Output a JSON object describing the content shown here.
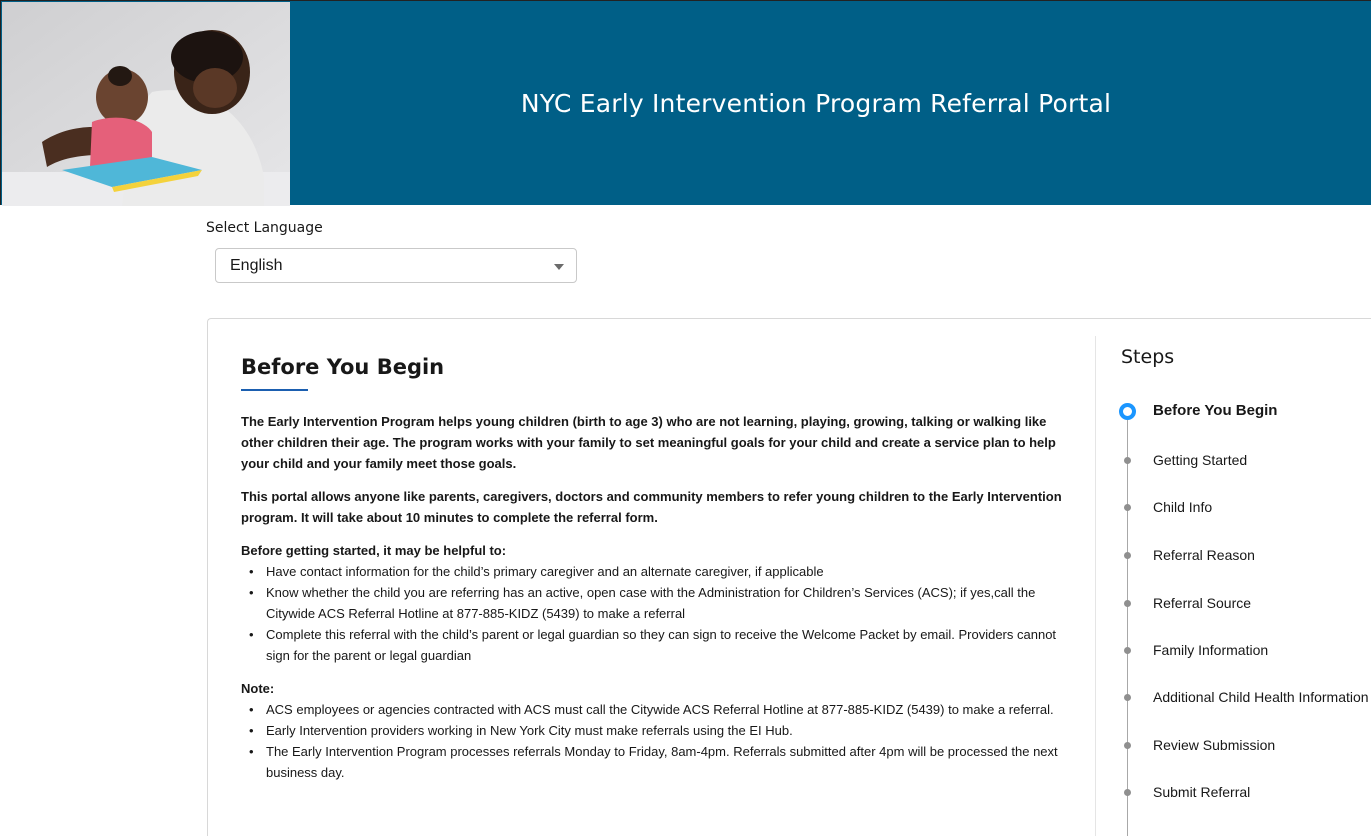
{
  "header": {
    "title": "NYC Early Intervention Program Referral Portal"
  },
  "language": {
    "label": "Select Language",
    "selected": "English"
  },
  "main": {
    "title": "Before You Begin",
    "intro1": "The Early Intervention Program helps young children (birth to age 3) who are not learning, playing, growing, talking or walking like other children their age. The program works with your family to set meaningful goals for your child and create a service plan to help your child and your family meet those goals.",
    "intro2": "This portal allows anyone like parents, caregivers, doctors and community members to refer young children to the Early Intervention program. It will take about 10 minutes to complete the referral form.",
    "helpful_heading": "Before getting started, it may be helpful to:",
    "helpful_items": [
      "Have contact information for the child’s primary caregiver and an alternate caregiver, if applicable",
      "Know whether the child you are referring has an active, open case with the Administration for Children’s Services (ACS); if yes,call the Citywide ACS Referral Hotline at 877-885-KIDZ (5439) to make a referral",
      "Complete this referral with the child’s parent or legal guardian so they can sign to receive the Welcome Packet by email. Providers cannot sign for the parent or legal guardian"
    ],
    "note_heading": "Note:",
    "note_items": [
      "ACS employees or agencies contracted with ACS must call the Citywide ACS Referral Hotline at 877-885-KIDZ (5439) to make a referral.",
      "Early Intervention providers working in New York City must make referrals using the EI Hub.",
      "The Early Intervention Program processes referrals Monday to Friday, 8am-4pm. Referrals submitted after 4pm will be processed the next business day."
    ]
  },
  "steps": {
    "title": "Steps",
    "items": [
      {
        "label": "Before You Begin",
        "current": true
      },
      {
        "label": "Getting Started",
        "current": false
      },
      {
        "label": "Child Info",
        "current": false
      },
      {
        "label": "Referral Reason",
        "current": false
      },
      {
        "label": "Referral Source",
        "current": false
      },
      {
        "label": "Family Information",
        "current": false
      },
      {
        "label": "Additional Child Health Information",
        "current": false
      },
      {
        "label": "Review Submission",
        "current": false
      },
      {
        "label": "Submit Referral",
        "current": false
      }
    ]
  },
  "colors": {
    "header_bg": "#005f87",
    "accent_blue": "#1b96ff",
    "underline_blue": "#1b5fb0"
  }
}
